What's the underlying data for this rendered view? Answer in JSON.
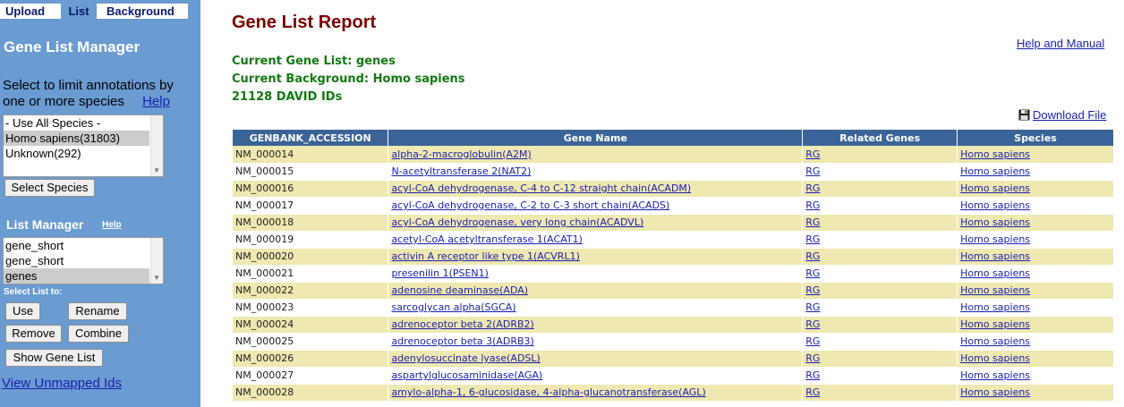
{
  "tabs": {
    "upload": "Upload",
    "list": "List",
    "background": "Background"
  },
  "sidebar": {
    "title": "Gene List Manager",
    "species_prompt": "Select to limit annotations by one or more species",
    "species_help": "Help",
    "species_options": [
      {
        "label": "- Use All Species -",
        "selected": false
      },
      {
        "label": "Homo sapiens(31803)",
        "selected": true
      },
      {
        "label": "Unknown(292)",
        "selected": false
      }
    ],
    "select_species_button": "Select Species",
    "list_manager_title": "List Manager",
    "list_manager_help": "Help",
    "list_options": [
      {
        "label": "gene_short",
        "selected": false
      },
      {
        "label": "gene_short",
        "selected": false
      },
      {
        "label": "genes",
        "selected": true
      }
    ],
    "select_list_label": "Select List to:",
    "buttons": {
      "use": "Use",
      "rename": "Rename",
      "remove": "Remove",
      "combine": "Combine",
      "show_gene_list": "Show Gene List"
    },
    "view_unmapped": "View Unmapped Ids"
  },
  "main": {
    "title": "Gene List Report",
    "help_manual": "Help and Manual",
    "current_list": "Current Gene List: genes",
    "current_background": "Current Background: Homo sapiens",
    "id_count": "21128 DAVID IDs",
    "download": "Download File"
  },
  "table": {
    "headers": [
      "GENBANK_ACCESSION",
      "Gene Name",
      "Related Genes",
      "Species"
    ],
    "rows": [
      {
        "acc": "NM_000014",
        "name": "alpha-2-macroglobulin(A2M)",
        "rel": "RG",
        "species": "Homo sapiens"
      },
      {
        "acc": "NM_000015",
        "name": "N-acetyltransferase 2(NAT2)",
        "rel": "RG",
        "species": "Homo sapiens"
      },
      {
        "acc": "NM_000016",
        "name": "acyl-CoA dehydrogenase, C-4 to C-12 straight chain(ACADM)",
        "rel": "RG",
        "species": "Homo sapiens"
      },
      {
        "acc": "NM_000017",
        "name": "acyl-CoA dehydrogenase, C-2 to C-3 short chain(ACADS)",
        "rel": "RG",
        "species": "Homo sapiens"
      },
      {
        "acc": "NM_000018",
        "name": "acyl-CoA dehydrogenase, very long chain(ACADVL)",
        "rel": "RG",
        "species": "Homo sapiens"
      },
      {
        "acc": "NM_000019",
        "name": "acetyl-CoA acetyltransferase 1(ACAT1)",
        "rel": "RG",
        "species": "Homo sapiens"
      },
      {
        "acc": "NM_000020",
        "name": "activin A receptor like type 1(ACVRL1)",
        "rel": "RG",
        "species": "Homo sapiens"
      },
      {
        "acc": "NM_000021",
        "name": "presenilin 1(PSEN1)",
        "rel": "RG",
        "species": "Homo sapiens"
      },
      {
        "acc": "NM_000022",
        "name": "adenosine deaminase(ADA)",
        "rel": "RG",
        "species": "Homo sapiens"
      },
      {
        "acc": "NM_000023",
        "name": "sarcoglycan alpha(SGCA)",
        "rel": "RG",
        "species": "Homo sapiens"
      },
      {
        "acc": "NM_000024",
        "name": "adrenoceptor beta 2(ADRB2)",
        "rel": "RG",
        "species": "Homo sapiens"
      },
      {
        "acc": "NM_000025",
        "name": "adrenoceptor beta 3(ADRB3)",
        "rel": "RG",
        "species": "Homo sapiens"
      },
      {
        "acc": "NM_000026",
        "name": "adenylosuccinate lyase(ADSL)",
        "rel": "RG",
        "species": "Homo sapiens"
      },
      {
        "acc": "NM_000027",
        "name": "aspartylglucosaminidase(AGA)",
        "rel": "RG",
        "species": "Homo sapiens"
      },
      {
        "acc": "NM_000028",
        "name": "amylo-alpha-1, 6-glucosidase, 4-alpha-glucanotransferase(AGL)",
        "rel": "RG",
        "species": "Homo sapiens"
      }
    ]
  }
}
